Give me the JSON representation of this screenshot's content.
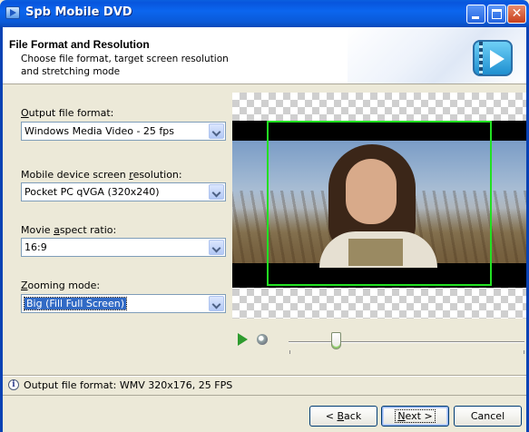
{
  "window": {
    "title": "Spb Mobile DVD"
  },
  "header": {
    "title": "File Format and Resolution",
    "subtitle": "Choose file format, target screen resolution and stretching mode"
  },
  "form": {
    "output_format": {
      "label_prefix": "",
      "label_accel": "O",
      "label_rest": "utput file format:",
      "value": "Windows Media Video - 25 fps"
    },
    "resolution": {
      "label_prefix": "Mobile device screen ",
      "label_accel": "r",
      "label_rest": "esolution:",
      "value": "Pocket PC qVGA (320x240)"
    },
    "aspect": {
      "label_prefix": "Movie ",
      "label_accel": "a",
      "label_rest": "spect ratio:",
      "value": "16:9"
    },
    "zoom": {
      "label_prefix": "",
      "label_accel": "Z",
      "label_rest": "ooming mode:",
      "value": "Big (Fill Full Screen)"
    }
  },
  "player": {
    "icons": [
      "play-icon",
      "zoom-icon"
    ],
    "position_fraction": 0.2
  },
  "status": {
    "text": "Output file format: WMV 320x176, 25 FPS",
    "icon": "info-icon"
  },
  "buttons": {
    "back_prefix": "< ",
    "back_accel": "B",
    "back_rest": "ack",
    "next_accel": "N",
    "next_rest": "ext >",
    "cancel": "Cancel"
  },
  "colors": {
    "titlebar": "#0a5fe0",
    "frame_highlight": "#22e022",
    "selection": "#316ac5"
  }
}
